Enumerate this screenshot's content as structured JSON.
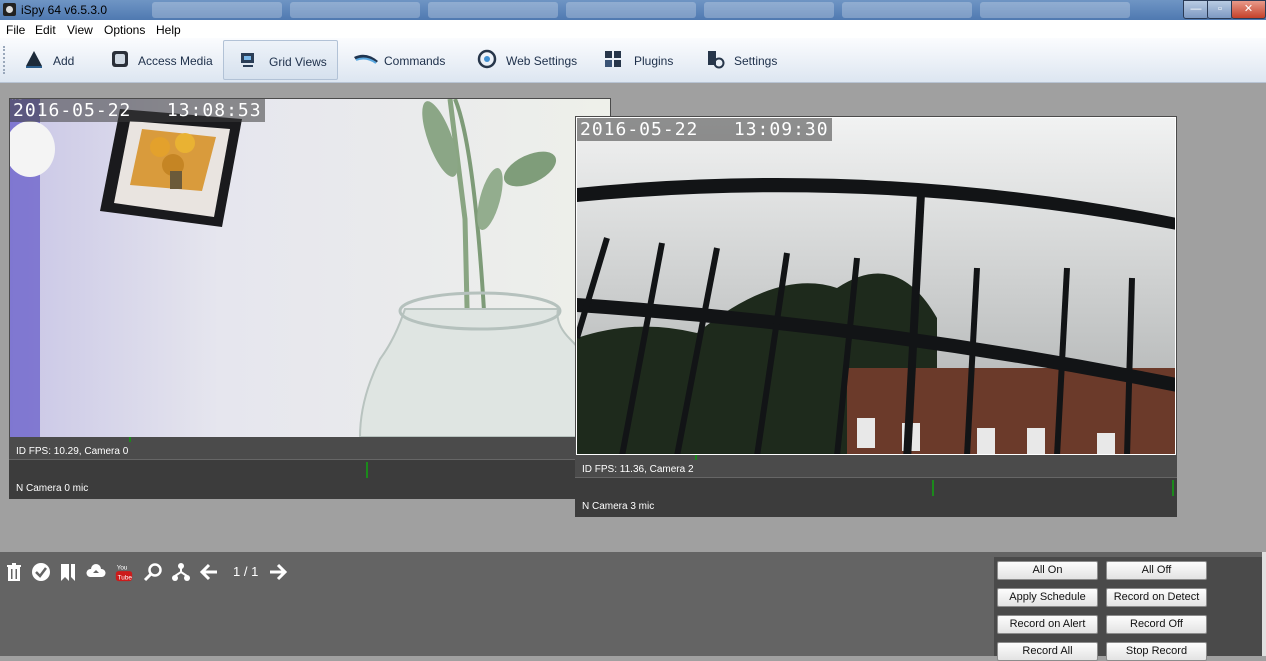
{
  "window": {
    "title": "iSpy 64 v6.5.3.0",
    "minimize_glyph": "—",
    "maximize_glyph": "▫",
    "close_glyph": "✕"
  },
  "menu": {
    "file": "File",
    "edit": "Edit",
    "view": "View",
    "options": "Options",
    "help": "Help"
  },
  "toolbar": {
    "add": "Add",
    "access_media": "Access Media",
    "grid_views": "Grid Views",
    "commands": "Commands",
    "web_settings": "Web Settings",
    "plugins": "Plugins",
    "settings": "Settings"
  },
  "cameras": [
    {
      "timestamp": "2016-05-22   13:08:53",
      "status": "ID  FPS: 10.29, Camera 0",
      "mic_label": "N  Camera 0 mic"
    },
    {
      "timestamp": "2016-05-22   13:09:30",
      "status": "ID  FPS: 11.36, Camera 2",
      "mic_label": "N  Camera 3 mic"
    }
  ],
  "bottom": {
    "page_indicator": "1 / 1",
    "icons": [
      "trash-icon",
      "check-icon",
      "bookmark-icon",
      "cloud-upload-icon",
      "youtube-icon",
      "search-icon",
      "network-icon",
      "arrow-left-icon",
      "arrow-right-icon"
    ]
  },
  "controls": {
    "all_on": "All On",
    "all_off": "All Off",
    "apply_schedule": "Apply Schedule",
    "record_on_detect": "Record on Detect",
    "record_on_alert": "Record on Alert",
    "record_off": "Record Off",
    "record_all": "Record All",
    "stop_record": "Stop Record"
  },
  "colors": {
    "titlebar": "#5a82b8",
    "toolbar": "#e4ebf4",
    "main_bg": "#a0a0a0",
    "bottom_bg": "#646464",
    "mic_level": "#1b8a1b"
  }
}
